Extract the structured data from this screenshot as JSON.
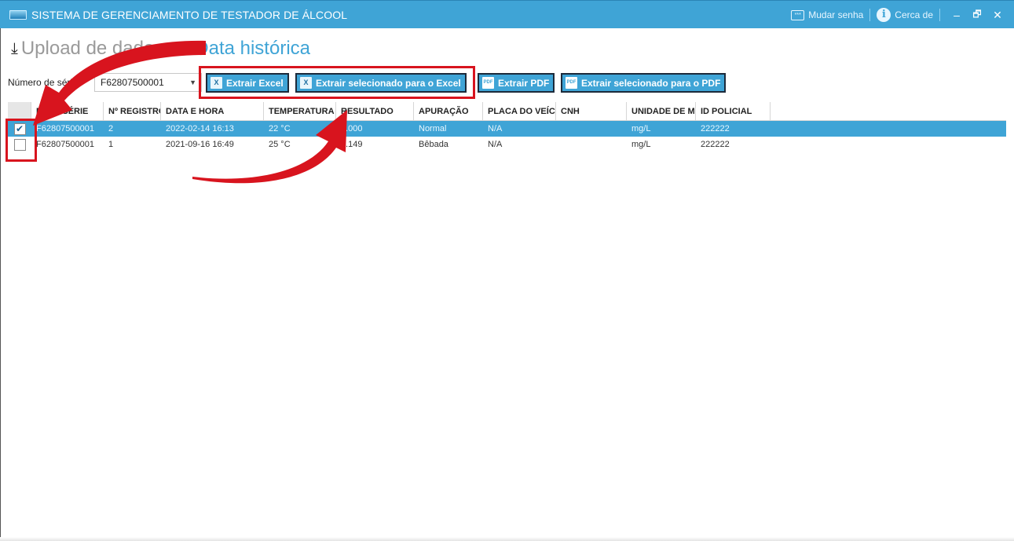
{
  "window": {
    "title": "SISTEMA DE GERENCIAMENTO DE TESTADOR DE ÁLCOOL",
    "change_password": "Mudar senha",
    "about": "Cerca de",
    "minimize": "–",
    "restore": "🗗",
    "close": "✕"
  },
  "tabs": {
    "upload": "Upload de dados",
    "history": "Data histórica"
  },
  "toolbar": {
    "serial_label": "Número de série.",
    "serial_value": "F62807500001",
    "extract_excel": "Extrair Excel",
    "extract_selected_excel": "Extrair selecionado para o Excel",
    "extract_pdf": "Extrair PDF",
    "extract_selected_pdf": "Extrair selecionado para o PDF"
  },
  "table": {
    "columns": [
      "Nº DE SÉRIE",
      "Nº REGISTRO",
      "DATA E HORA",
      "TEMPERATURA",
      "RESULTADO",
      "APURAÇÃO",
      "PLACA DO VEÍCULO",
      "CNH",
      "UNIDADE DE MEDIDA",
      "ID POLICIAL"
    ],
    "rows": [
      {
        "checked": true,
        "serial": "F62807500001",
        "record": "2",
        "datetime": "2022-02-14 16:13",
        "temperature": "22 °C",
        "result": "0.000",
        "verdict": "Normal",
        "plate": "N/A",
        "cnh": "",
        "unit": "mg/L",
        "police_id": "222222"
      },
      {
        "checked": false,
        "serial": "F62807500001",
        "record": "1",
        "datetime": "2021-09-16 16:49",
        "temperature": "25 °C",
        "result": "0.149",
        "verdict": "Bêbada",
        "plate": "N/A",
        "cnh": "",
        "unit": "mg/L",
        "police_id": "222222"
      }
    ]
  },
  "colors": {
    "accent": "#3fa4d6",
    "highlight": "#d8141e"
  }
}
